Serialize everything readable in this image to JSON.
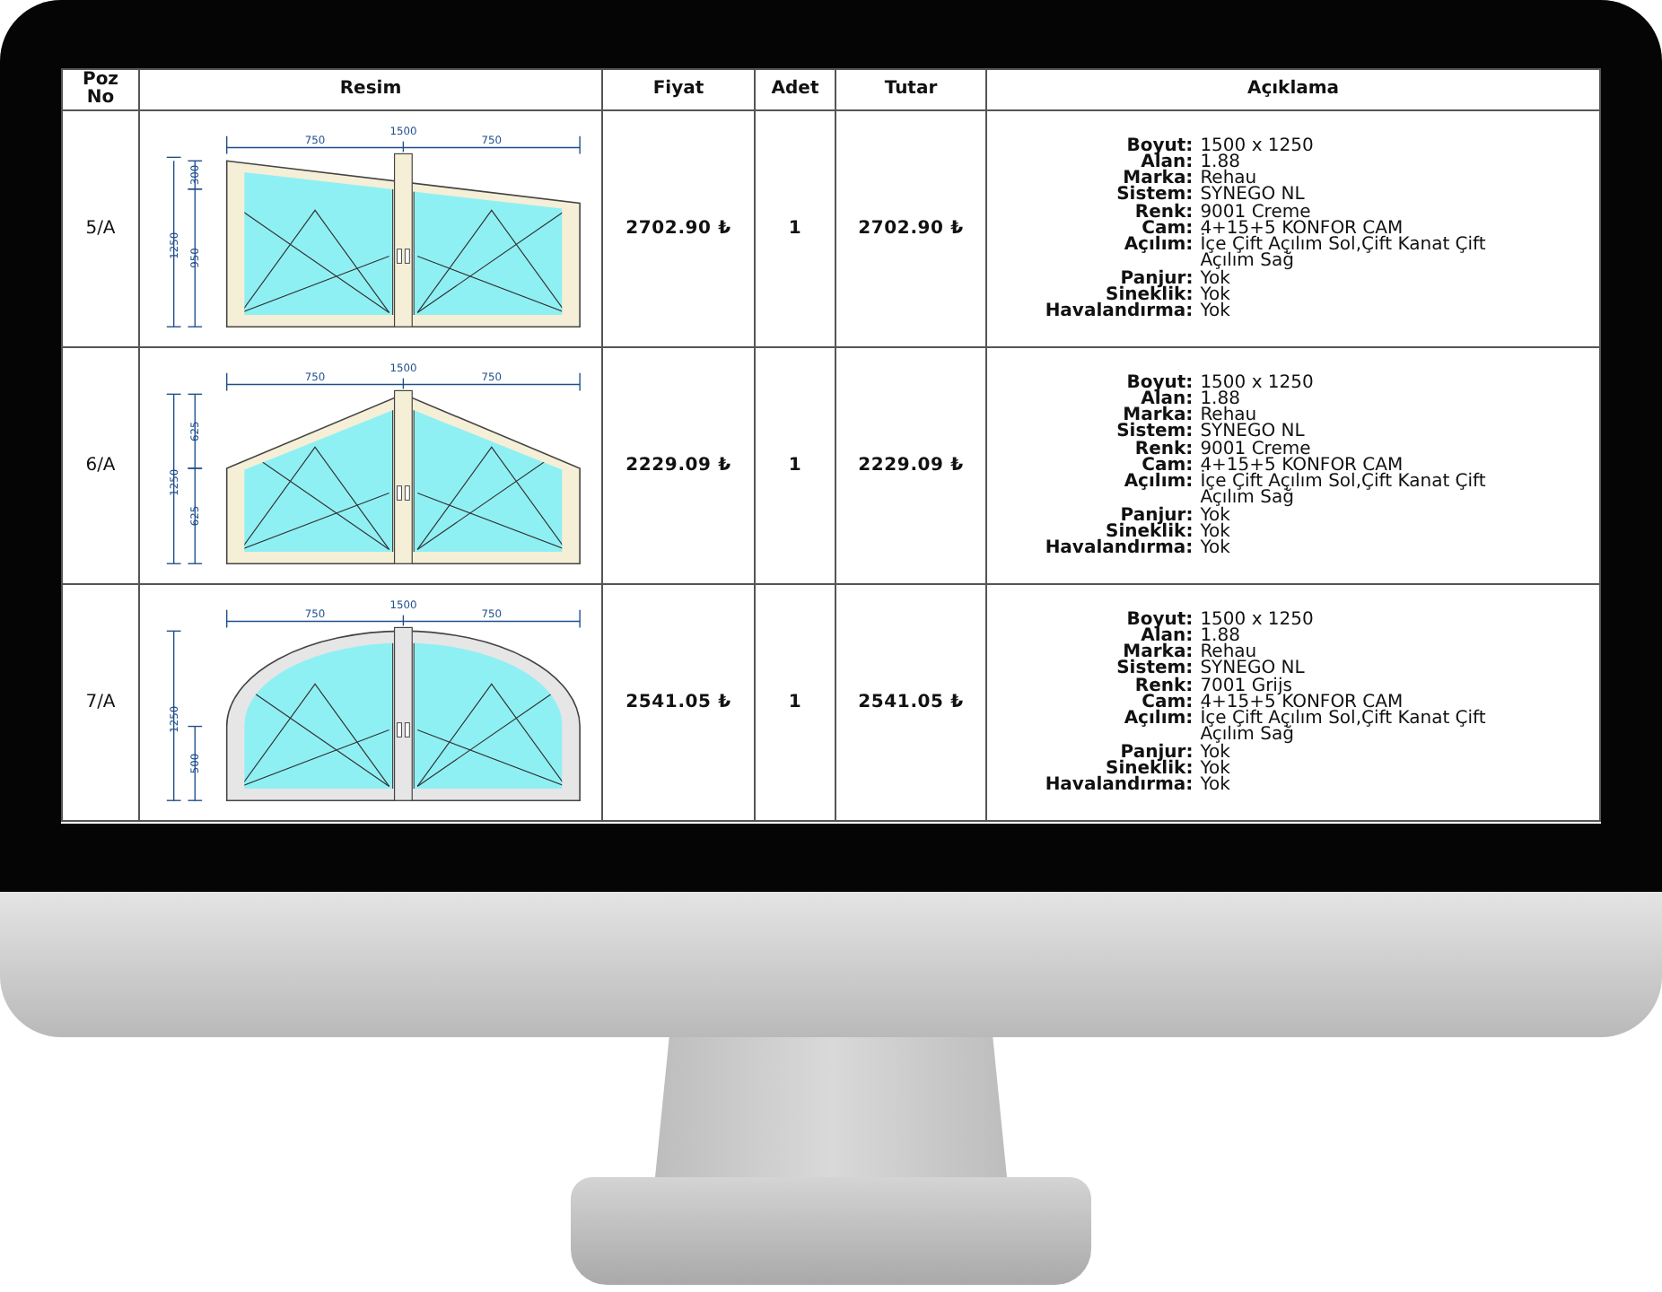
{
  "table": {
    "columns": [
      "Poz\nNo",
      "Resim",
      "Fiyat",
      "Adet",
      "Tutar",
      "Açıklama"
    ],
    "rows": [
      {
        "position": "5/A",
        "drawing": {
          "kind": "trapezoid",
          "color": "#f4efd6",
          "width_dims": [
            "750",
            "1500",
            "750"
          ],
          "height_dims": [
            "1250",
            "300",
            "950"
          ]
        },
        "price": "2702.90 ₺",
        "quantity": "1",
        "total": "2702.90 ₺",
        "details": [
          {
            "label": "Boyut:",
            "value": "1500 x 1250"
          },
          {
            "label": "Alan:",
            "value": "1.88"
          },
          {
            "label": "Marka:",
            "value": "Rehau"
          },
          {
            "label": "Sistem:",
            "value": "SYNEGO NL"
          },
          {
            "label": "Renk:",
            "value": "9001 Creme"
          },
          {
            "label": "Cam:",
            "value": "4+15+5 KONFOR CAM"
          },
          {
            "label": "Açılım:",
            "value": "İçe Çift Açılım Sol,Çift Kanat Çift Açılım Sağ"
          },
          {
            "label": "Panjur:",
            "value": "Yok"
          },
          {
            "label": "Sineklik:",
            "value": "Yok"
          },
          {
            "label": "Havalandırma:",
            "value": "Yok"
          }
        ]
      },
      {
        "position": "6/A",
        "drawing": {
          "kind": "gable",
          "color": "#f4efd6",
          "width_dims": [
            "750",
            "1500",
            "750"
          ],
          "height_dims": [
            "1250",
            "625",
            "625"
          ]
        },
        "price": "2229.09 ₺",
        "quantity": "1",
        "total": "2229.09 ₺",
        "details": [
          {
            "label": "Boyut:",
            "value": "1500 x 1250"
          },
          {
            "label": "Alan:",
            "value": "1.88"
          },
          {
            "label": "Marka:",
            "value": "Rehau"
          },
          {
            "label": "Sistem:",
            "value": "SYNEGO NL"
          },
          {
            "label": "Renk:",
            "value": "9001 Creme"
          },
          {
            "label": "Cam:",
            "value": "4+15+5 KONFOR CAM"
          },
          {
            "label": "Açılım:",
            "value": "İçe Çift Açılım Sol,Çift Kanat Çift Açılım Sağ"
          },
          {
            "label": "Panjur:",
            "value": "Yok"
          },
          {
            "label": "Sineklik:",
            "value": "Yok"
          },
          {
            "label": "Havalandırma:",
            "value": "Yok"
          }
        ]
      },
      {
        "position": "7/A",
        "drawing": {
          "kind": "arch",
          "color": "#e6e6e6",
          "width_dims": [
            "750",
            "1500",
            "750"
          ],
          "height_dims": [
            "1250",
            "500"
          ]
        },
        "price": "2541.05 ₺",
        "quantity": "1",
        "total": "2541.05 ₺",
        "details": [
          {
            "label": "Boyut:",
            "value": "1500 x 1250"
          },
          {
            "label": "Alan:",
            "value": "1.88"
          },
          {
            "label": "Marka:",
            "value": "Rehau"
          },
          {
            "label": "Sistem:",
            "value": "SYNEGO NL"
          },
          {
            "label": "Renk:",
            "value": "7001 Grijs"
          },
          {
            "label": "Cam:",
            "value": "4+15+5 KONFOR CAM"
          },
          {
            "label": "Açılım:",
            "value": "İçe Çift Açılım Sol,Çift Kanat Çift Açılım Sağ"
          },
          {
            "label": "Panjur:",
            "value": "Yok"
          },
          {
            "label": "Sineklik:",
            "value": "Yok"
          },
          {
            "label": "Havalandırma:",
            "value": "Yok"
          }
        ]
      }
    ]
  }
}
